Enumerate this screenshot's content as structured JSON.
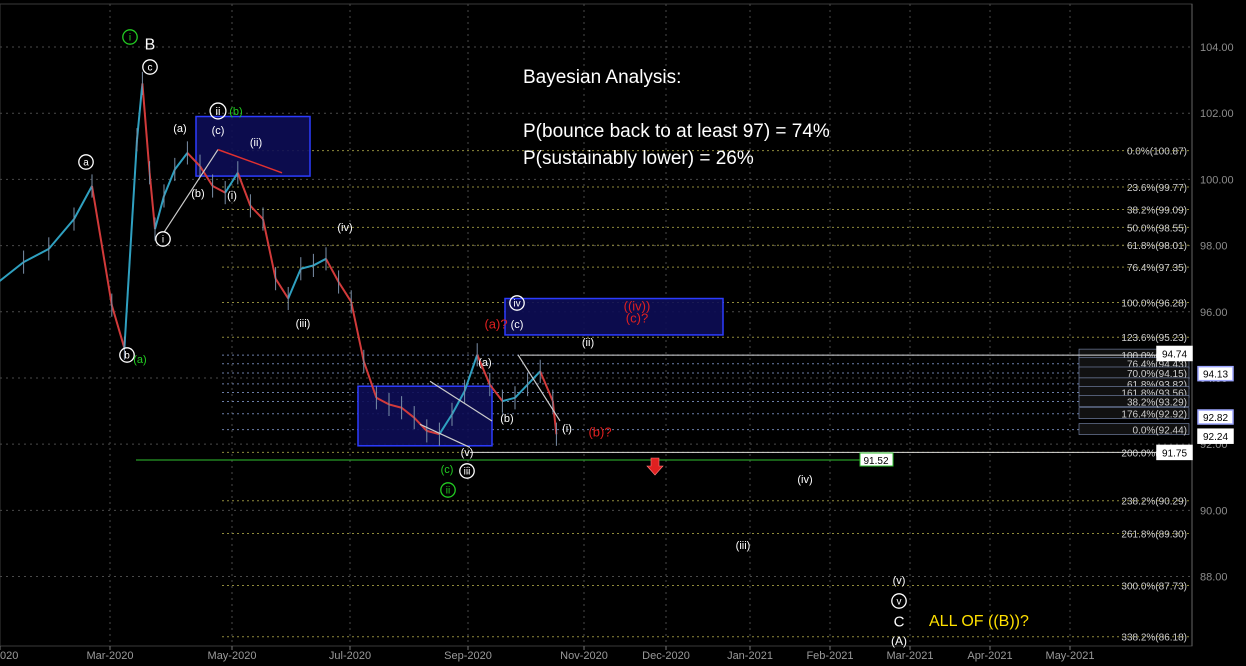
{
  "chart_data": {
    "type": "line",
    "title": "",
    "y_axis": {
      "side": "right",
      "range": [
        85.9,
        105.3
      ],
      "ticks": [
        "104.00",
        "102.00",
        "100.00",
        "98.00",
        "96.00",
        "94.00",
        "92.00",
        "90.00",
        "88.00"
      ],
      "grid": true
    },
    "x_axis": {
      "ticks": [
        "020",
        "Mar-2020",
        "May-2020",
        "Jul-2020",
        "Sep-2020",
        "Nov-2020",
        "Dec-2020",
        "Jan-2021",
        "Feb-2021",
        "Mar-2021",
        "Apr-2021",
        "May-2021"
      ],
      "grid": true
    },
    "price_series": {
      "name": "",
      "note_dates": "weekly closes estimated from chart, Feb-2020 to Nov-2020",
      "x": [
        "2019-12-30",
        "2020-01-13",
        "2020-01-27",
        "2020-02-10",
        "2020-02-20",
        "2020-03-02",
        "2020-03-09",
        "2020-03-16",
        "2020-03-19",
        "2020-03-23",
        "2020-03-26",
        "2020-03-31",
        "2020-04-06",
        "2020-04-13",
        "2020-04-20",
        "2020-04-27",
        "2020-05-04",
        "2020-05-11",
        "2020-05-18",
        "2020-05-25",
        "2020-06-01",
        "2020-06-08",
        "2020-06-15",
        "2020-06-22",
        "2020-06-29",
        "2020-07-06",
        "2020-07-13",
        "2020-07-20",
        "2020-07-27",
        "2020-08-03",
        "2020-08-10",
        "2020-08-17",
        "2020-08-24",
        "2020-08-31",
        "2020-09-07",
        "2020-09-14",
        "2020-09-21",
        "2020-09-28",
        "2020-10-05",
        "2020-10-12",
        "2020-10-19",
        "2020-10-26",
        "2020-11-02",
        "2020-11-04"
      ],
      "y": [
        96.9,
        97.5,
        97.9,
        98.8,
        99.8,
        96.2,
        94.9,
        101.2,
        102.9,
        100.2,
        98.5,
        99.5,
        100.3,
        100.8,
        100.4,
        99.8,
        99.6,
        100.2,
        99.2,
        98.8,
        97.0,
        96.4,
        97.3,
        97.4,
        97.6,
        96.9,
        96.3,
        94.5,
        93.4,
        93.2,
        93.1,
        92.8,
        92.4,
        92.3,
        92.9,
        93.6,
        94.7,
        93.8,
        93.3,
        93.4,
        93.8,
        94.2,
        93.3,
        92.3
      ]
    },
    "fib_levels": [
      {
        "label": "0.0%(100.87)",
        "value": 100.87
      },
      {
        "label": "23.6%(99.77)",
        "value": 99.77
      },
      {
        "label": "38.2%(99.09)",
        "value": 99.09
      },
      {
        "label": "50.0%(98.55)",
        "value": 98.55
      },
      {
        "label": "61.8%(98.01)",
        "value": 98.01
      },
      {
        "label": "76.4%(97.35)",
        "value": 97.35
      },
      {
        "label": "100.0%(96.28)",
        "value": 96.28
      },
      {
        "label": "123.6%(95.23)",
        "value": 95.23
      },
      {
        "label": "100.0%(94.69)",
        "value": 94.69
      },
      {
        "label": "76.4%(94.43)",
        "value": 94.43
      },
      {
        "label": "70.0%(94.15)",
        "value": 94.15
      },
      {
        "label": "61.8%(93.82)",
        "value": 93.82
      },
      {
        "label": "161.8%(93.56)",
        "value": 93.56
      },
      {
        "label": "38.2%(93.29)",
        "value": 93.29
      },
      {
        "label": "176.4%(92.92)",
        "value": 92.92
      },
      {
        "label": "0.0%(92.44)",
        "value": 92.44
      },
      {
        "label": "200.0%(91.75)",
        "value": 91.75
      },
      {
        "label": "238.2%(90.29)",
        "value": 90.29
      },
      {
        "label": "261.8%(89.30)",
        "value": 89.3
      },
      {
        "label": "300.0%(87.73)",
        "value": 87.73
      },
      {
        "label": "338.2%(86.18)",
        "value": 86.18
      }
    ],
    "price_badges": [
      {
        "text": "94.74",
        "value": 94.74,
        "color": "#ffffff"
      },
      {
        "text": "94.13",
        "value": 94.13,
        "color": "#9da6ff"
      },
      {
        "text": "92.82",
        "value": 92.82,
        "color": "#9da6ff"
      },
      {
        "text": "92.24",
        "value": 92.24,
        "color": "#ffffff"
      },
      {
        "text": "91.75",
        "value": 91.75,
        "color": "#ffffff"
      }
    ],
    "support_line": {
      "text": "91.52",
      "value": 91.52,
      "color": "#2fbf2f"
    },
    "annotation_box": {
      "lines": [
        "Bayesian Analysis:",
        "",
        "P(bounce back to at least 97) = 74%",
        "P(sustainably lower) = 26%"
      ]
    },
    "footer_text": "ALL OF ((B))?",
    "wave_labels": [
      {
        "text": "B",
        "color": "#ffffff"
      },
      {
        "text": "c",
        "color": "#ffffff"
      },
      {
        "text": "a",
        "color": "#ffffff"
      },
      {
        "text": "i",
        "color": "#ffffff"
      },
      {
        "text": "ii",
        "color": "#ffffff"
      },
      {
        "text": "b",
        "color": "#ffffff"
      },
      {
        "text": "(a)",
        "color": "#ffffff"
      },
      {
        "text": "(c)",
        "color": "#ffffff"
      },
      {
        "text": "(b)",
        "color": "#ffffff"
      },
      {
        "text": "(i)",
        "color": "#ffffff"
      },
      {
        "text": "(ii)",
        "color": "#ffffff"
      },
      {
        "text": "(iii)",
        "color": "#ffffff"
      },
      {
        "text": "(iv)",
        "color": "#ffffff"
      },
      {
        "text": "(v)",
        "color": "#ffffff"
      },
      {
        "text": "iii",
        "color": "#ffffff"
      },
      {
        "text": "iv",
        "color": "#ffffff"
      },
      {
        "text": "v",
        "color": "#ffffff"
      },
      {
        "text": "C",
        "color": "#ffffff"
      },
      {
        "text": "(A)",
        "color": "#ffffff"
      },
      {
        "text": "(a)?",
        "color": "#e02020"
      },
      {
        "text": "((iv))",
        "color": "#e02020"
      },
      {
        "text": "(c)?",
        "color": "#e02020"
      },
      {
        "text": "(b)?",
        "color": "#e02020"
      },
      {
        "text": "i",
        "color": "#22cc22"
      },
      {
        "text": "(b)",
        "color": "#22cc22"
      },
      {
        "text": "(a)",
        "color": "#22cc22"
      },
      {
        "text": "(c)",
        "color": "#22cc22"
      },
      {
        "text": "ii",
        "color": "#22cc22"
      }
    ]
  }
}
